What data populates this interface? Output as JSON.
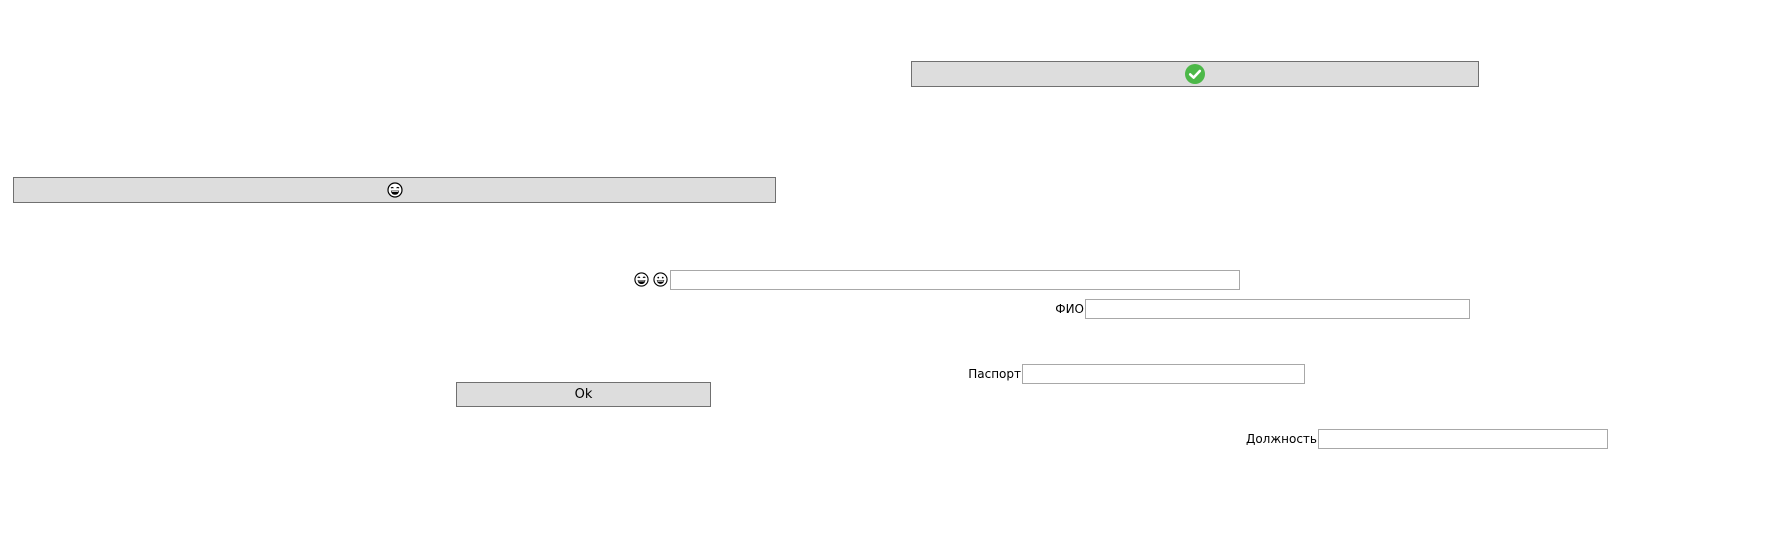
{
  "buttons": {
    "top_confirm": {
      "icon": "check-circle-icon",
      "icon_color": "#4cb848"
    },
    "wide_emoji": {
      "icon": "laughing-emoji-icon"
    },
    "ok_label": "Ok"
  },
  "emoji_row": {
    "icons": [
      "laughing-emoji-icon",
      "grinning-emoji-icon"
    ],
    "input_value": ""
  },
  "form": {
    "fio_label": "ФИО",
    "fio_value": "",
    "passport_label": "Паспорт",
    "passport_value": "",
    "position_label": "Должность",
    "position_value": ""
  },
  "colors": {
    "button_bg": "#dddddd",
    "button_border": "#707070",
    "input_border": "#a8a8a8",
    "check_green": "#4cb848"
  }
}
